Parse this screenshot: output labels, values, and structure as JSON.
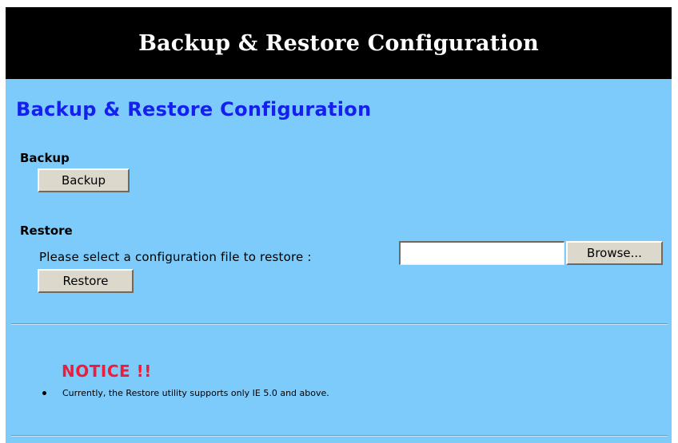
{
  "banner": {
    "title": "Backup & Restore Configuration"
  },
  "page": {
    "heading": "Backup & Restore Configuration"
  },
  "backup": {
    "label": "Backup",
    "button_label": "Backup"
  },
  "restore": {
    "label": "Restore",
    "prompt": "Please select a configuration file to restore :",
    "file_value": "",
    "browse_label": "Browse...",
    "button_label": "Restore"
  },
  "notice": {
    "heading": "NOTICE !!",
    "items": [
      "Currently, the Restore utility supports only IE 5.0 and above."
    ]
  },
  "colors": {
    "page_background": "#7ccbfa",
    "banner_background": "#000000",
    "heading_color": "#1420ee",
    "notice_color": "#ee1c3c",
    "button_face": "#dcd8cc"
  }
}
